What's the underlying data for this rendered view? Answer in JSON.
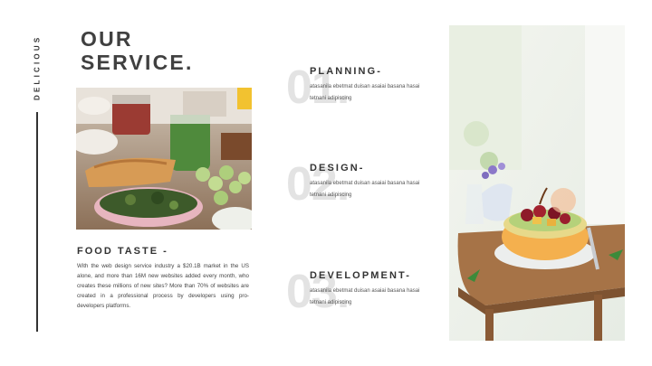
{
  "brand": {
    "vertical_label": "DELICIOUS"
  },
  "title": {
    "line1": "OUR",
    "line2": "SERVICE."
  },
  "food": {
    "heading": "FOOD TASTE -",
    "text": "With the web design service industry a $20.1B market in the US alone, and more than 16M new websites added every month, who creates these millions of new sites? More than 70% of websites are created in a professional process by developers using pro-developers platforms."
  },
  "services": [
    {
      "number": "01.",
      "heading": "PLANNING-",
      "desc": "atasanila ebetmat duisan asaiai basana hasai tetnani adipiscing"
    },
    {
      "number": "02.",
      "heading": "DESIGN-",
      "desc": "atasanila ebetmat duisan asaiai basana hasai tetnani adipiscing"
    },
    {
      "number": "03.",
      "heading": "DEVELOPMENT-",
      "desc": "atasanila ebetmat duisan asaiai basana hasai tetnani adipiscing"
    }
  ],
  "colors": {
    "text": "#333333",
    "number_watermark": "#e3e3e3",
    "background": "#ffffff"
  }
}
